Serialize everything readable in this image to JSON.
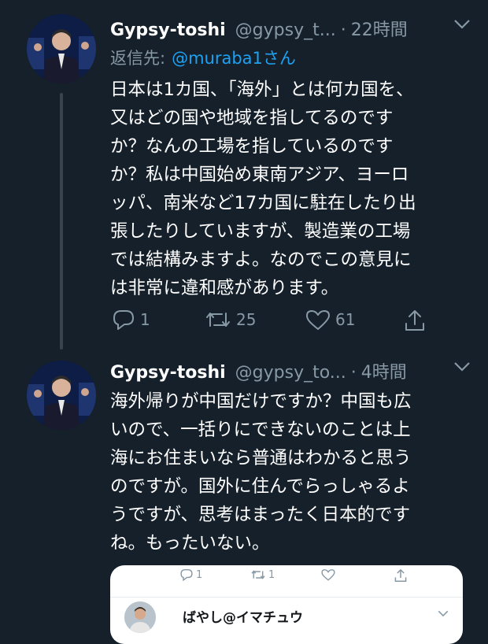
{
  "tweets": [
    {
      "author_name": "Gypsy-toshi",
      "handle": "@gypsy_t...",
      "separator": "·",
      "time": "22時間",
      "reply_prefix": "返信先:",
      "reply_to": "@muraba1さん",
      "text_lines": [
        "日本は1カ国、「海外」とは何カ国を、",
        "又はどの国や地域を指してるのです",
        "か？なんの工場を指しているのです",
        "か？私は中国始め東南アジア、ヨーロ",
        "ッパ、南米など17カ国に駐在したり出",
        "張したりしていますが、製造業の工場",
        "では結構みますよ。なのでこの意見に",
        "は非常に違和感があります。"
      ],
      "reply_count": "1",
      "retweet_count": "25",
      "like_count": "61",
      "avatar_icon": "person-portrait-avatar"
    },
    {
      "author_name": "Gypsy-toshi",
      "handle": "@gypsy_to...",
      "separator": "·",
      "time": "4時間",
      "text_lines": [
        "海外帰りが中国だけですか？中国も広",
        "いので、一括りにできないのことは上",
        "海にお住まいなら普通はわかると思う",
        "のですが。国外に住んでらっしゃるよ",
        "うですが、思考はまったく日本的です",
        "ね。もったいない。"
      ],
      "avatar_icon": "person-portrait-avatar"
    }
  ],
  "embedded_card": {
    "reply_count": "1",
    "retweet_count": "1",
    "author_name": "ばやし@イマチュウ"
  },
  "colors": {
    "background": "#15202b",
    "secondary_text": "#8899a6",
    "accent": "#1da1f2",
    "thread_line": "#38444d"
  }
}
